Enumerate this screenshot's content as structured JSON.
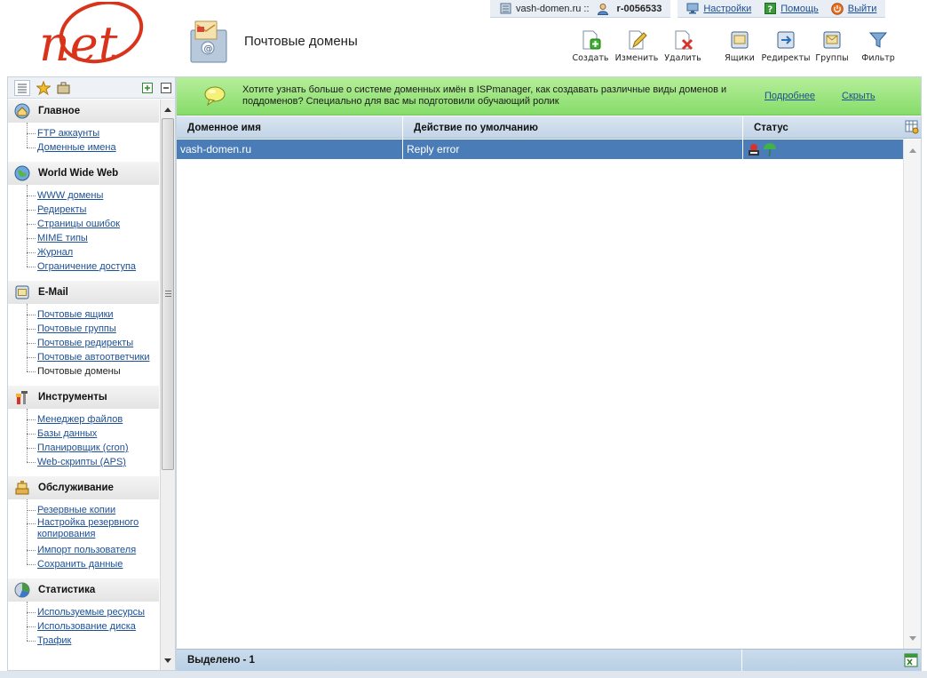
{
  "logo": {
    "text": "net",
    "brand_color": "#d9341b"
  },
  "infobar": {
    "domain": "vash-domen.ru ::",
    "user_id": "r-0056533",
    "links": {
      "settings": "Настройки",
      "help": "Помощь",
      "logout": "Выйти"
    }
  },
  "page": {
    "title": "Почтовые домены"
  },
  "toolbar": {
    "create": "Создать",
    "edit": "Изменить",
    "delete": "Удалить",
    "mailboxes": "Ящики",
    "redirects": "Редиректы",
    "groups": "Группы",
    "filter": "Фильтр"
  },
  "sidebar": {
    "sections": [
      {
        "title": "Главное",
        "icon": "home-icon",
        "items": [
          "FTP аккаунты",
          "Доменные имена"
        ]
      },
      {
        "title": "World Wide Web",
        "icon": "globe-icon",
        "items": [
          "WWW домены",
          "Редиректы",
          "Страницы ошибок",
          "MIME типы",
          "Журнал",
          "Ограничение доступа"
        ]
      },
      {
        "title": "E-Mail",
        "icon": "mail-icon",
        "items": [
          "Почтовые ящики",
          "Почтовые группы",
          "Почтовые редиректы",
          "Почтовые автоответчики",
          "Почтовые домены"
        ]
      },
      {
        "title": "Инструменты",
        "icon": "tools-icon",
        "items": [
          "Менеджер файлов",
          "Базы данных",
          "Планировщик (cron)",
          "Web-скрипты (APS)"
        ]
      },
      {
        "title": "Обслуживание",
        "icon": "maintenance-icon",
        "items": [
          "Резервные копии",
          "Настройка резервного копирования",
          "Импорт пользователя",
          "Сохранить данные"
        ]
      },
      {
        "title": "Статистика",
        "icon": "stats-icon",
        "items": [
          "Используемые ресурсы",
          "Использование диска",
          "Трафик"
        ]
      }
    ],
    "active_item": "Почтовые домены"
  },
  "banner": {
    "text": "Хотите узнать больше о системе доменных имён в ISPmanager, как создавать различные виды доменов и поддоменов? Специально для вас мы подготовили обучающий ролик",
    "more": "Подробнее",
    "hide": "Скрыть",
    "background": "#98e37c"
  },
  "table": {
    "columns": [
      "Доменное имя",
      "Действие по умолчанию",
      "Статус"
    ],
    "rows": [
      {
        "domain": "vash-domen.ru",
        "action": "Reply error",
        "status_icons": [
          "spam-filter-icon",
          "umbrella-icon"
        ]
      }
    ],
    "selected_row_color": "#4a7db8",
    "footer": "Выделено - 1"
  }
}
